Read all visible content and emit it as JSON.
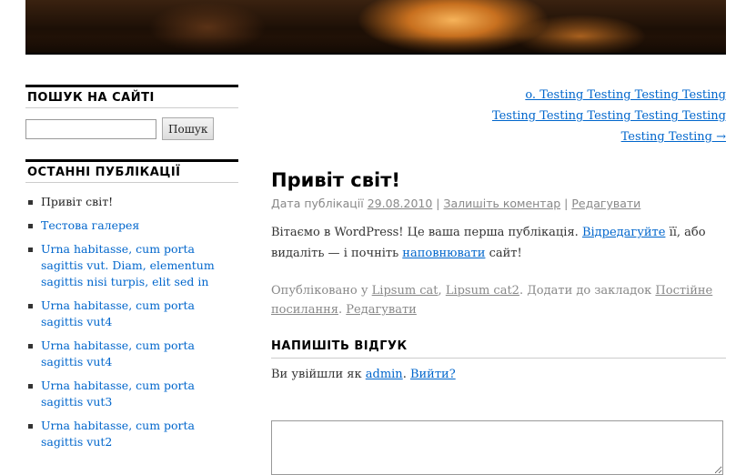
{
  "header": {
    "banner_alt": "cave-header-image"
  },
  "sidebar": {
    "search_title": "ПОШУК НА САЙТІ",
    "search_input_value": "",
    "search_button": "Пошук",
    "recent_title": "ОСТАННІ ПУБЛІКАЦІЇ",
    "recent": [
      {
        "label": "Привіт світ!",
        "link": false
      },
      {
        "label": "Тестова галерея",
        "link": true
      },
      {
        "label": "Urna habitasse, cum porta sagittis vut. Diam, elementum sagittis nisi turpis, elit sed in",
        "link": true
      },
      {
        "label": "Urna habitasse, cum porta sagittis vut4",
        "link": true
      },
      {
        "label": "Urna habitasse, cum porta sagittis vut4",
        "link": true
      },
      {
        "label": "Urna habitasse, cum porta sagittis vut3",
        "link": true
      },
      {
        "label": "Urna habitasse, cum porta sagittis vut2",
        "link": true
      }
    ]
  },
  "nav": {
    "line1": "o. Testing Testing Testing Testing",
    "line2": "Testing Testing Testing Testing Testing",
    "line3": "Testing Testing →"
  },
  "post": {
    "title": "Привіт світ!",
    "meta_prefix": "Дата публікації",
    "date": "29.08.2010",
    "sep": "|",
    "leave_comment": "Залишіть коментар",
    "edit": "Редагувати",
    "body_1": "Вітаємо в WordPress! Це ваша перша публікація.",
    "body_link1": "Відредагуйте",
    "body_2": "її, або видаліть — і почніть",
    "body_link2": "наповнювати",
    "body_3": "сайт!",
    "published_in": "Опубліковано у",
    "cat1": "Lipsum cat",
    "comma": ",",
    "cat2": "Lipsum cat2",
    "bookmark_text": ". Додати до закладок",
    "permalink": "Постійне посилання",
    "dot": ".",
    "edit2": "Редагувати"
  },
  "reply": {
    "title": "НАПИШІТЬ ВІДГУК",
    "logged_prefix": "Ви увійшли як",
    "user": "admin",
    "dot": ".",
    "logout": "Вийти?"
  }
}
